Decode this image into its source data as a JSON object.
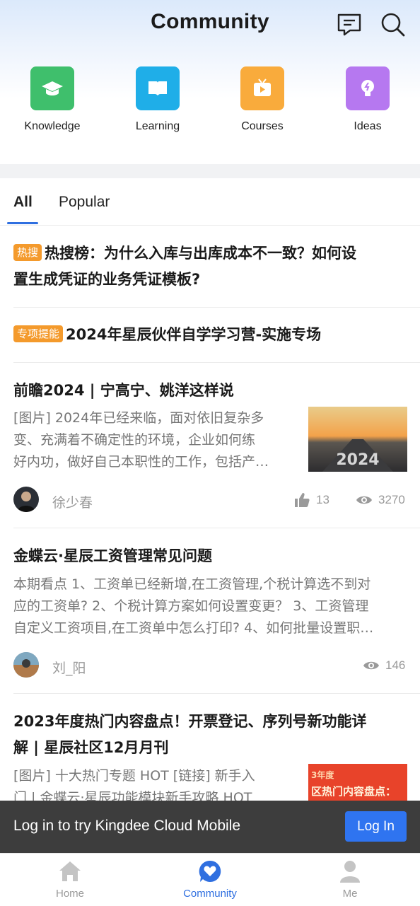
{
  "header": {
    "title": "Community",
    "icons": [
      "chat-icon",
      "search-icon"
    ]
  },
  "categories": [
    {
      "label": "Knowledge",
      "icon": "graduation-cap-icon",
      "color": "#3fbf6c"
    },
    {
      "label": "Learning",
      "icon": "book-icon",
      "color": "#1faee8"
    },
    {
      "label": "Courses",
      "icon": "tv-play-icon",
      "color": "#f9ab3c"
    },
    {
      "label": "Ideas",
      "icon": "lightbulb-icon",
      "color": "#b678f0"
    }
  ],
  "tabs": [
    {
      "label": "All",
      "active": true
    },
    {
      "label": "Popular",
      "active": false
    }
  ],
  "feed": {
    "hot": {
      "badge": "热搜",
      "title_line1": "热搜榜：为什么入库与出库成本不一致？如何设",
      "title_line2": "置生成凭证的业务凭证模板?"
    },
    "special": {
      "badge": "专项提能",
      "title": "2024年星辰伙伴自学学习营-实施专场"
    },
    "posts": [
      {
        "title": "前瞻2024 | 宁高宁、姚洋这样说",
        "excerpt": [
          "[图片] 2024年已经来临，面对依旧复杂多",
          "变、充满着不确定性的环境，企业如何练",
          "好内功，做好自己本职性的工作，包括产…"
        ],
        "author": "徐少春",
        "likes": "13",
        "views": "3270",
        "thumb_text": "2024"
      },
      {
        "title": "金蝶云·星辰工资管理常见问题",
        "excerpt": [
          "本期看点 1、工资单已经新增,在工资管理,个税计算选不到对",
          "应的工资单? 2、个税计算方案如何设置变更？ 3、工资管理",
          "自定义工资项目,在工资单中怎么打印? 4、如何批量设置职…"
        ],
        "author": "刘_阳",
        "views": "146"
      },
      {
        "title_line1": "2023年度热门内容盘点！开票登记、序列号新功能详",
        "title_line2": "解 | 星辰社区12月月刊",
        "excerpt": [
          "[图片] 十大热门专题 HOT [链接] 新手入",
          "门 | 金蝶云·星辰功能模块新手攻略 HOT"
        ],
        "thumb_text_1": "3年度",
        "thumb_text_2": "区热门内容盘点："
      }
    ]
  },
  "login_bar": {
    "text": "Log in to try Kingdee Cloud Mobile",
    "button": "Log In"
  },
  "bottom_nav": [
    {
      "label": "Home",
      "icon": "home-icon",
      "active": false
    },
    {
      "label": "Community",
      "icon": "heart-chat-icon",
      "active": true
    },
    {
      "label": "Me",
      "icon": "person-icon",
      "active": false
    }
  ],
  "colors": {
    "accent": "#2f6fe0",
    "badge": "#f49a2c",
    "login_bar": "#3d3d3d"
  }
}
